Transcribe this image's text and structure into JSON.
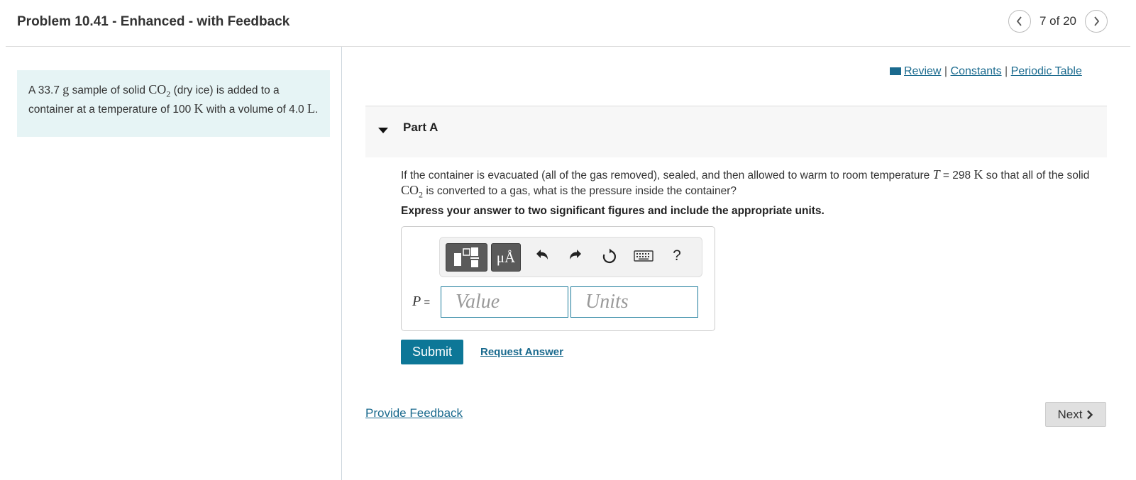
{
  "header": {
    "title": "Problem 10.41 - Enhanced - with Feedback",
    "pager": {
      "prev_icon": "chevron-left-icon",
      "label": "7 of 20",
      "next_icon": "chevron-right-icon"
    }
  },
  "intro": {
    "t1": "A 33.7 ",
    "m1": "g",
    "t2": " sample of solid ",
    "m2": "CO",
    "m2_sub": "2",
    "t3": " (dry ice) is added to a container at a temperature of 100 ",
    "m3": "K",
    "t4": " with a volume of 4.0 ",
    "m4": "L",
    "t5": "."
  },
  "links": {
    "review": "Review",
    "constants": "Constants",
    "periodic": "Periodic Table",
    "sep": "|"
  },
  "part": {
    "label": "Part A"
  },
  "question": {
    "t1": "If the container is evacuated (all of the gas removed), sealed, and then allowed to warm to room temperature ",
    "var": "T",
    "t2": " = 298 ",
    "unit": "K",
    "t3": " so that all of the solid ",
    "co": "CO",
    "co_sub": "2",
    "t4": " is converted to a gas, what is the pressure inside the container?"
  },
  "instruction": "Express your answer to two significant figures and include the appropriate units.",
  "toolbar": {
    "templates_icon": "templates-icon",
    "units_label": "μÅ",
    "undo_icon": "undo-icon",
    "redo_icon": "redo-icon",
    "reset_icon": "reset-icon",
    "keyboard_icon": "keyboard-icon",
    "help_label": "?"
  },
  "answer": {
    "var_label": "P",
    "eq": " =",
    "value_placeholder": "Value",
    "units_placeholder": "Units"
  },
  "actions": {
    "submit": "Submit",
    "request": "Request Answer"
  },
  "footer": {
    "feedback": "Provide Feedback",
    "next": "Next"
  },
  "colors": {
    "accent": "#0d7797",
    "link": "#1a6a8e",
    "intro_bg": "#e6f4f5"
  }
}
